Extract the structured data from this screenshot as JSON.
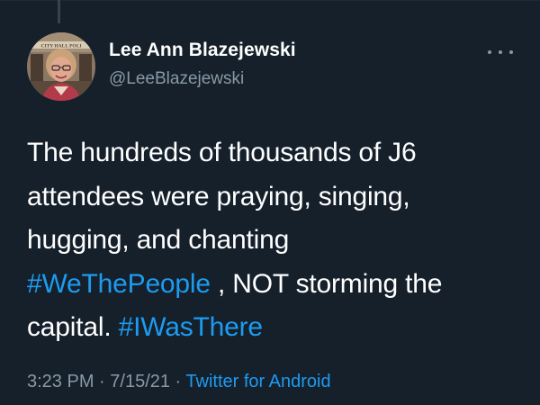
{
  "tweet": {
    "display_name": "Lee Ann Blazejewski",
    "handle": "@LeeBlazejewski",
    "more_icon": "more-horizontal-icon",
    "text": {
      "line1": "The hundreds of thousands of J6",
      "line2": "attendees were praying, singing,",
      "line3": "hugging, and chanting",
      "hashtag1": "#WeThePeople",
      "line4_rest": " , NOT storming the",
      "line5_start": "capital. ",
      "hashtag2": "#IWasThere"
    },
    "time": "3:23 PM",
    "separator1": " · ",
    "date": "7/15/21",
    "separator2": " · ",
    "source": "Twitter for Android",
    "avatar_sign_text": "CITY HALL POLI"
  },
  "colors": {
    "background": "#15202b",
    "text": "#ffffff",
    "muted": "#8899a6",
    "link": "#1d9bf0"
  }
}
